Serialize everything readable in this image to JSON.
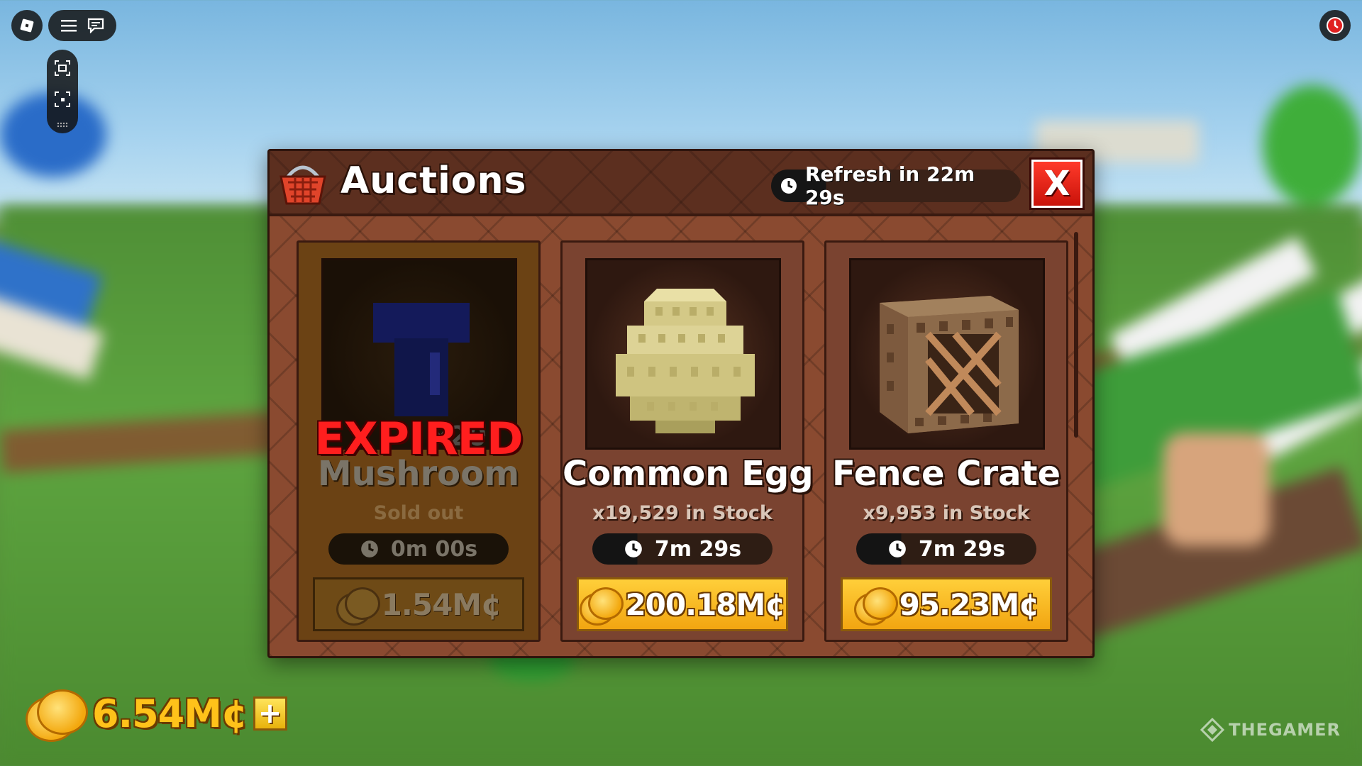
{
  "hud": {
    "currency": "6.54M¢",
    "plus_label": "+"
  },
  "auctions": {
    "title": "Auctions",
    "refresh_label": "Refresh in 22m 29s",
    "close_label": "X",
    "items": [
      {
        "name": "Mushroom",
        "status_stamp": "EXPIRED",
        "stock_label": "Sold out",
        "quantity_badge": "x20",
        "timer": "0m 00s",
        "price": "1.54M¢",
        "expired": true
      },
      {
        "name": "Common Egg",
        "stock_label": "x19,529 in Stock",
        "timer": "7m 29s",
        "price": "200.18M¢",
        "expired": false
      },
      {
        "name": "Fence Crate",
        "stock_label": "x9,953 in Stock",
        "timer": "7m 29s",
        "price": "95.23M¢",
        "expired": false
      }
    ]
  },
  "watermark": "THEGAMER",
  "icons": {
    "basket": "basket-icon",
    "clock": "clock-icon",
    "coin": "coin-icon"
  },
  "colors": {
    "panel": "#6a3725",
    "price_button": "#f2a511",
    "close_button": "#d9180e",
    "expired_text": "#ff1e1e",
    "currency_text": "#ffc21a"
  }
}
